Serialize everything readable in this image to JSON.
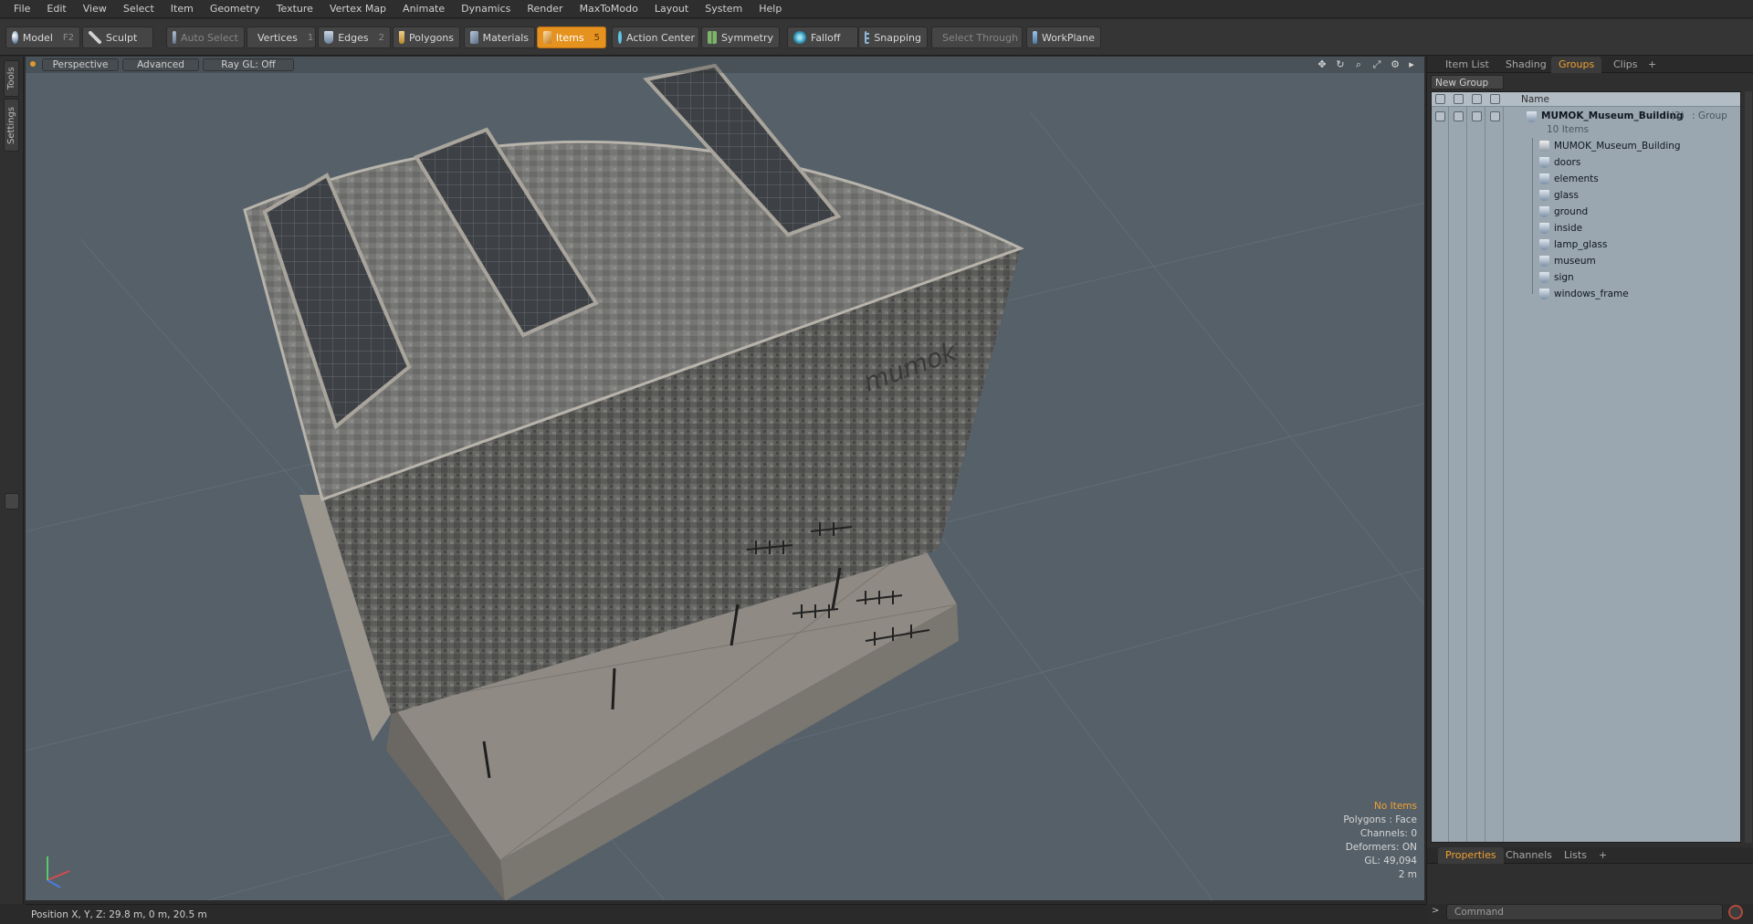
{
  "menu": [
    "File",
    "Edit",
    "View",
    "Select",
    "Item",
    "Geometry",
    "Texture",
    "Vertex Map",
    "Animate",
    "Dynamics",
    "Render",
    "MaxToModo",
    "Layout",
    "System",
    "Help"
  ],
  "toolbar": {
    "model": "Model",
    "model_key": "F2",
    "sculpt": "Sculpt",
    "auto_select": "Auto Select",
    "vertices": "Vertices",
    "vertices_key": "1",
    "edges": "Edges",
    "edges_key": "2",
    "polygons": "Polygons",
    "materials": "Materials",
    "items": "Items",
    "items_key": "5",
    "action_center": "Action Center",
    "symmetry": "Symmetry",
    "falloff": "Falloff",
    "snapping": "Snapping",
    "select_through": "Select Through",
    "workplane": "WorkPlane"
  },
  "left_tabs": {
    "tools": "Tools",
    "settings": "Settings"
  },
  "viewport": {
    "view_mode": "Perspective",
    "shading": "Advanced",
    "raygl": "Ray GL: Off",
    "sign_text": "mumok",
    "stats": {
      "selection": "No Items",
      "polygons": "Polygons : Face",
      "channels": "Channels: 0",
      "deformers": "Deformers: ON",
      "gl": "GL: 49,094",
      "scale": "2 m"
    }
  },
  "status": {
    "position": "Position X, Y, Z:   29.8 m, 0 m, 20.5 m"
  },
  "right_panel": {
    "tabs": [
      "Item List",
      "Shading",
      "Groups",
      "Clips",
      "+"
    ],
    "active_tab": "Groups",
    "new_group": "New Group",
    "name_header": "Name",
    "group": {
      "name": "MUMOK_Museum_Building",
      "count": "(2)",
      "type": ": Group",
      "items": "10 Items"
    },
    "children": [
      "MUMOK_Museum_Building",
      "doors",
      "elements",
      "glass",
      "ground",
      "inside",
      "lamp_glass",
      "museum",
      "sign",
      "windows_frame"
    ],
    "bottom_tabs": [
      "Properties",
      "Channels",
      "Lists",
      "+"
    ],
    "command_placeholder": "Command"
  },
  "colors": {
    "accent": "#e6921f",
    "viewport_bg": "#556069",
    "list_bg": "#9aa6b0"
  }
}
